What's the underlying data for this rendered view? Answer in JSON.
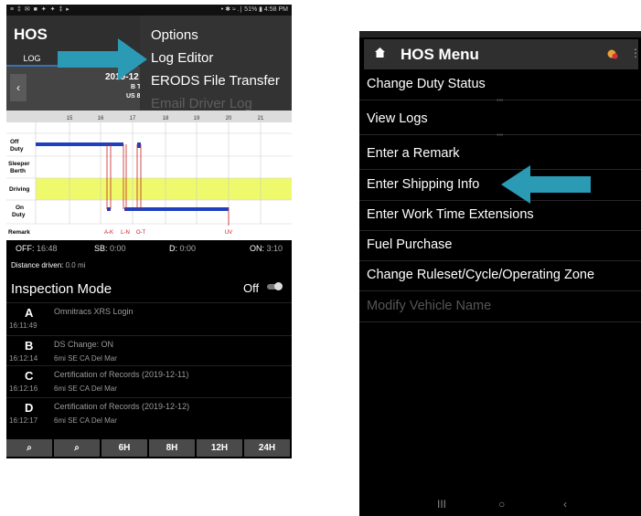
{
  "left_phone": {
    "status": {
      "left": "≡ ‡ ✉ ■ ✦ ✦ ‡ ▸",
      "right": "• ✱ ≈ .∣ 51% ▮ 4:58 PM"
    },
    "app_title": "HOS",
    "tab": "LOG",
    "options_menu": [
      "Options",
      "Log Editor",
      "ERODS File Transfer",
      "Email Driver Log"
    ],
    "date_text": "2019-12",
    "tz_line1": "B T",
    "tz_line2": "US 8",
    "prev_button": "‹",
    "graph": {
      "hours": [
        "15",
        "16",
        "17",
        "18",
        "19",
        "20",
        "21"
      ],
      "rows": [
        {
          "label_1": "Off",
          "label_2": "Duty"
        },
        {
          "label_1": "Sleeper",
          "label_2": "Berth"
        },
        {
          "label_1": "Driving",
          "label_2": ""
        },
        {
          "label_1": "On",
          "label_2": "Duty"
        }
      ],
      "remark_label": "Remark",
      "remarks": [
        "A-K",
        "L-N",
        "O-T",
        "UV"
      ]
    },
    "summary": {
      "off_label": "OFF:",
      "off_value": "16:48",
      "sb_label": "SB:",
      "sb_value": "0:00",
      "d_label": "D:",
      "d_value": "0:00",
      "on_label": "ON:",
      "on_value": "3:10",
      "distance_label": "Distance driven:",
      "distance_value": "0.0 mi"
    },
    "inspection": {
      "label": "Inspection Mode",
      "value": "Off"
    },
    "events": [
      {
        "letter": "A",
        "desc": "Omnitracs XRS Login",
        "time": "16:11:49",
        "loc": ""
      },
      {
        "letter": "B",
        "desc": "DS Change: ON",
        "time": "16:12:14",
        "loc": "6mi SE CA Del Mar"
      },
      {
        "letter": "C",
        "desc": "Certification of Records (2019-12-11)",
        "time": "16:12:16",
        "loc": "6mi SE CA Del Mar"
      },
      {
        "letter": "D",
        "desc": "Certification of Records (2019-12-12)",
        "time": "16:12:17",
        "loc": "6mi SE CA Del Mar"
      }
    ],
    "zoom_buttons": [
      "⌕",
      "⌕",
      "6H",
      "8H",
      "12H",
      "24H"
    ]
  },
  "right_phone": {
    "title": "HOS Menu",
    "items": [
      "Change Duty Status",
      "View Logs",
      "Enter a Remark",
      "Enter Shipping Info",
      "Enter Work Time Extensions",
      "Fuel Purchase",
      "Change Ruleset/Cycle/Operating Zone",
      "Modify Vehicle Name"
    ],
    "dots": "•••",
    "nav": [
      "III",
      "○",
      "‹"
    ],
    "kebab": "⋮"
  },
  "colors": {
    "accent_arrow": "#2b9ab4",
    "driving_band": "#eef96b",
    "log_line": "#1f3fbf",
    "remark_red": "#c82020"
  }
}
